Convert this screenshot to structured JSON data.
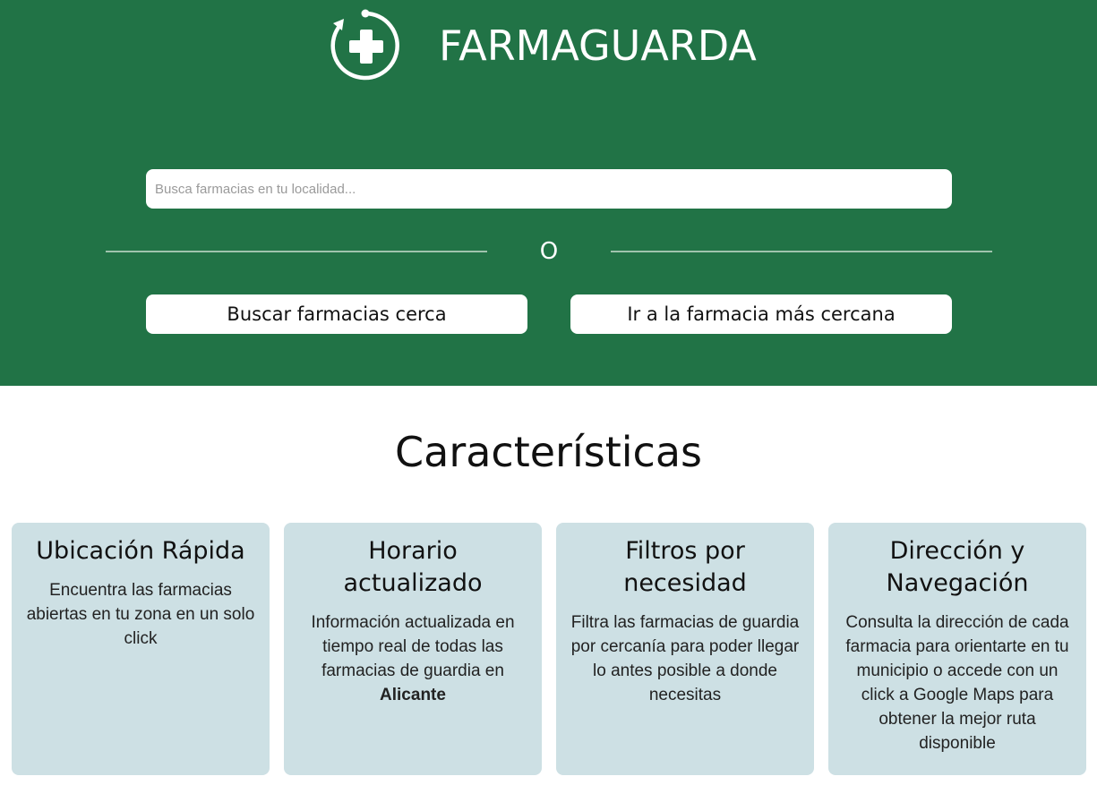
{
  "header": {
    "brand": "FARMAGUARDA",
    "logo_icon": "pharmacy-cross-refresh-icon"
  },
  "search": {
    "placeholder": "Busca farmacias en tu localidad...",
    "value": ""
  },
  "divider": {
    "label": "O"
  },
  "actions": {
    "near_label": "Buscar farmacias cerca",
    "closest_label": "Ir a la farmacia más cercana"
  },
  "features": {
    "title": "Características",
    "cards": [
      {
        "title": "Ubicación Rápida",
        "text": "Encuentra las farmacias abiertas en tu zona en un solo click"
      },
      {
        "title": "Horario actualizado",
        "text": "Información actualizada en tiempo real de todas las farmacias de guardia en",
        "highlight": "Alicante"
      },
      {
        "title": "Filtros por necesidad",
        "text": "Filtra las farmacias de guardia por cercanía para poder llegar lo antes posible a donde necesitas"
      },
      {
        "title": "Dirección y Navegación",
        "text": "Consulta la dirección de cada farmacia para orientarte en tu municipio o accede con un click a Google Maps para obtener la mejor ruta disponible"
      }
    ]
  },
  "colors": {
    "brand_green": "#217346",
    "card_bg": "#cde0e4",
    "white": "#ffffff"
  }
}
